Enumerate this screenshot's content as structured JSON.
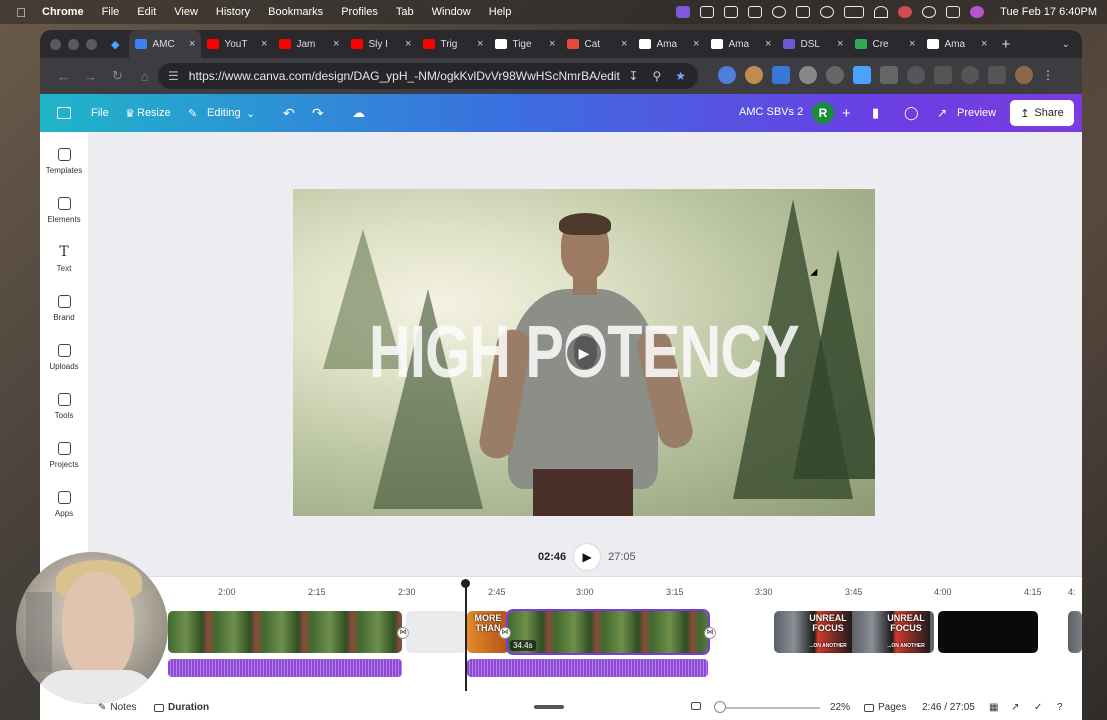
{
  "menubar": {
    "apple": "",
    "items": [
      "Chrome",
      "File",
      "Edit",
      "View",
      "History",
      "Bookmarks",
      "Profiles",
      "Tab",
      "Window",
      "Help"
    ],
    "clock": "Tue Feb 17  6:40PM"
  },
  "browser": {
    "tabs": [
      {
        "label": "AMC",
        "color": "#3b82f6",
        "active": true
      },
      {
        "label": "YouT",
        "color": "#ff0000"
      },
      {
        "label": "Jam",
        "color": "#ff0000"
      },
      {
        "label": "Sly I",
        "color": "#ff0000"
      },
      {
        "label": "Trig",
        "color": "#ff0000"
      },
      {
        "label": "Tige",
        "color": "#ffffff"
      },
      {
        "label": "Cat",
        "color": "#e84a3a"
      },
      {
        "label": "Ama",
        "color": "#ffffff"
      },
      {
        "label": "Ama",
        "color": "#ffffff"
      },
      {
        "label": "DSL",
        "color": "#6a5acd"
      },
      {
        "label": "Cre",
        "color": "#34a853"
      },
      {
        "label": "Ama",
        "color": "#ffffff"
      }
    ],
    "url": "https://www.canva.com/design/DAG_ypH_-NM/ogkKvlDvVr98WwHScNmrBA/edit"
  },
  "canva": {
    "header": {
      "file": "File",
      "resize": "Resize",
      "editing": "Editing",
      "design_name": "AMC SBVs 2",
      "avatar_initial": "R",
      "preview": "Preview",
      "share": "Share"
    },
    "rail": [
      {
        "label": "Templates",
        "icon": "templates-icon"
      },
      {
        "label": "Elements",
        "icon": "elements-icon"
      },
      {
        "label": "Text",
        "icon": "text-icon"
      },
      {
        "label": "Brand",
        "icon": "brand-icon"
      },
      {
        "label": "Uploads",
        "icon": "uploads-icon"
      },
      {
        "label": "Tools",
        "icon": "tools-icon"
      },
      {
        "label": "Projects",
        "icon": "projects-icon"
      },
      {
        "label": "Apps",
        "icon": "apps-icon"
      }
    ],
    "stage": {
      "title": "HIGH POTENCY"
    },
    "playback": {
      "current": "02:46",
      "total": "27:05"
    },
    "timeline": {
      "ticks": [
        "2:00",
        "2:15",
        "2:30",
        "2:45",
        "3:00",
        "3:15",
        "3:30",
        "3:45",
        "4:00",
        "4:15",
        "4:"
      ],
      "clip_label_more_than": "MORE THAN",
      "clip_duration": "34.4s",
      "clip_label_unreal_1": "UNREAL FOCUS",
      "clip_label_unreal_2": "UNREAL FOCUS",
      "clip_sub": "...ON ANOTHER LEVEL!"
    },
    "footer": {
      "notes": "Notes",
      "duration": "Duration",
      "zoom": "22%",
      "pages": "Pages",
      "time": "2:46 / 27:05"
    }
  }
}
